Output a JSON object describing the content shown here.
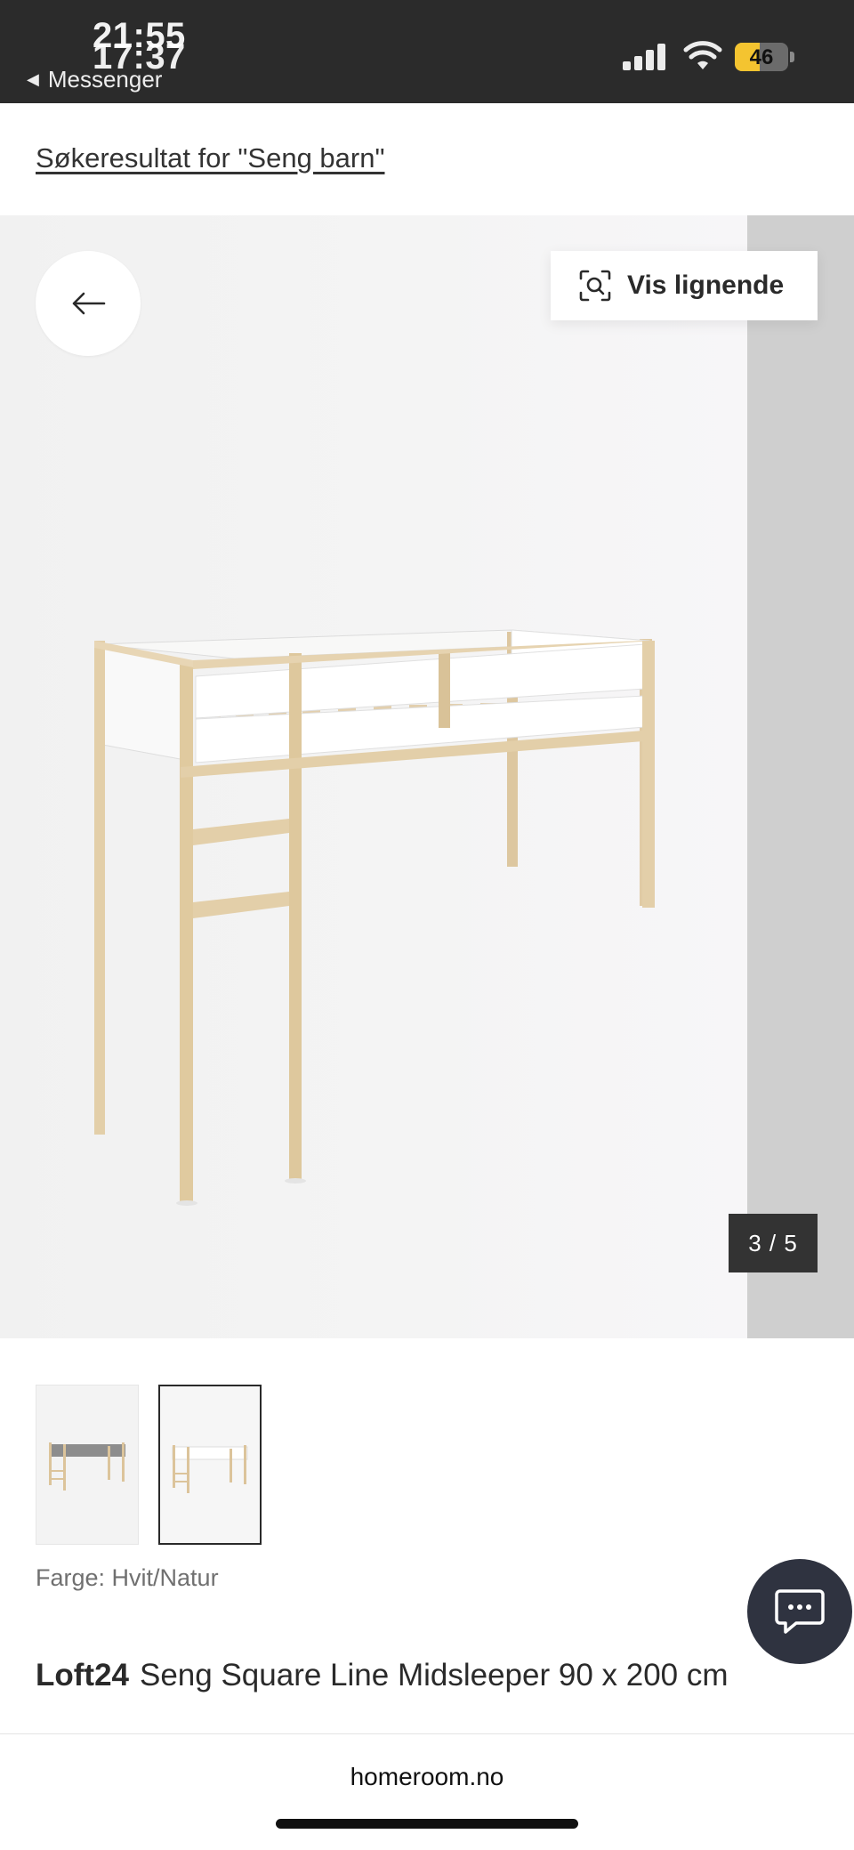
{
  "status_bar": {
    "time_primary": "21:55",
    "time_overlay": "17:37",
    "back_app_label": "Messenger",
    "battery_level": "46",
    "battery_color": "#f4c430"
  },
  "breadcrumb": {
    "label": "Søkeresultat for \"Seng barn\""
  },
  "gallery": {
    "back_icon": "arrow-left-icon",
    "similar_icon": "visual-search-icon",
    "similar_label": "Vis lignende",
    "counter": "3 / 5",
    "current_image": 3,
    "total_images": 5
  },
  "variants": {
    "color_label": "Farge: Hvit/Natur",
    "options": [
      {
        "name": "grey-natur",
        "selected": false
      },
      {
        "name": "hvit-natur",
        "selected": true
      }
    ]
  },
  "product": {
    "brand": "Loft24",
    "name": "Seng Square Line Midsleeper 90 x 200 cm"
  },
  "chat": {
    "icon": "chat-bubble-icon",
    "accent": "#2f3340"
  },
  "browser": {
    "url": "homeroom.no"
  }
}
